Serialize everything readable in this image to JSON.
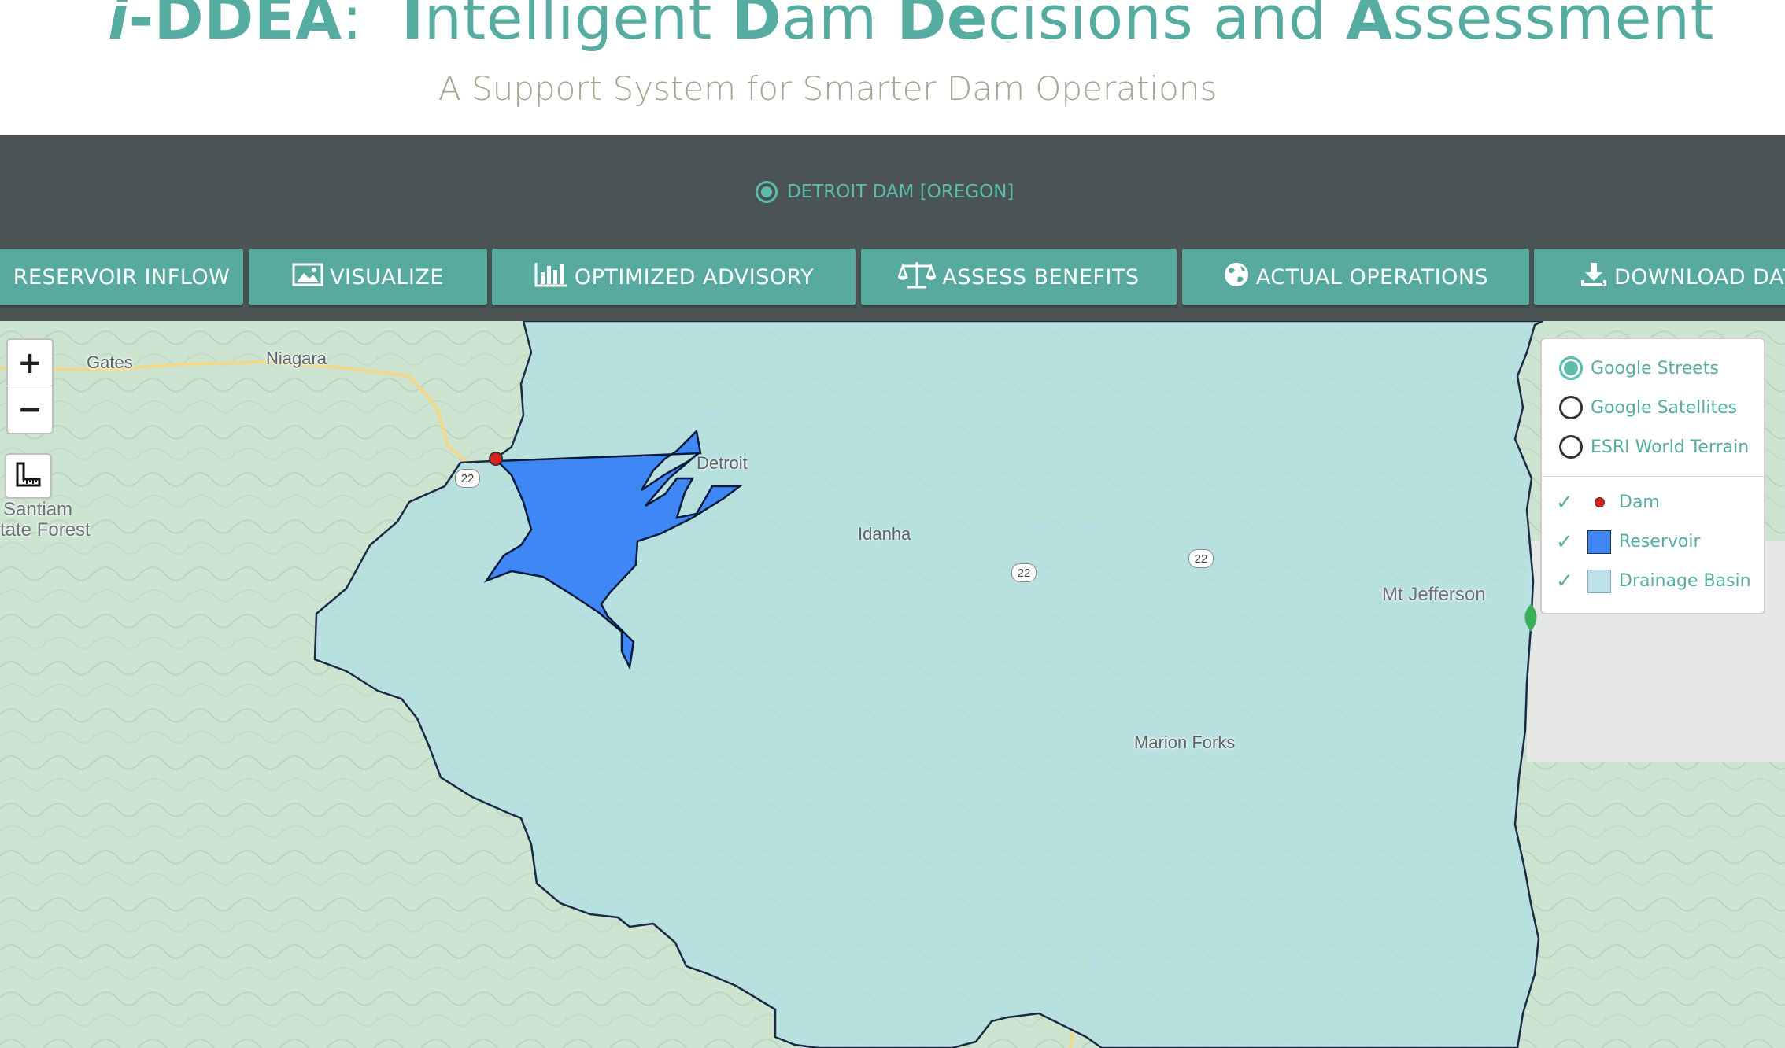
{
  "header": {
    "title": {
      "prefix_i": "i",
      "dash": "-",
      "acronym": "DDEA",
      "colon": ":",
      "w1_cap": "I",
      "w1_rest": "ntelligent",
      "w2_cap": "D",
      "w2_rest": "am",
      "w3_cap": "De",
      "w3_rest": "cisions and",
      "w4_cap": "A",
      "w4_rest": "ssessment"
    },
    "subtitle": "A Support System for Smarter Dam Operations"
  },
  "dam_selector": {
    "label": "DETROIT DAM [OREGON]"
  },
  "nav": {
    "reservoir_inflow": "RESERVOIR INFLOW",
    "visualize": "VISUALIZE",
    "optimized_advisory": "OPTIMIZED ADVISORY",
    "assess_benefits": "ASSESS BENEFITS",
    "actual_operations": "ACTUAL OPERATIONS",
    "download_data": "DOWNLOAD DATA"
  },
  "map": {
    "zoom_in": "+",
    "zoom_out": "−",
    "labels": {
      "gates": "Gates",
      "niagara": "Niagara",
      "detroit": "Detroit",
      "idanha": "Idanha",
      "santiam": "Santiam",
      "state_forest": "tate Forest",
      "mt_jefferson": "Mt Jefferson",
      "marion_forks": "Marion Forks"
    },
    "route_shield": "22"
  },
  "layers": {
    "base": [
      {
        "label": "Google Streets",
        "selected": true
      },
      {
        "label": "Google Satellites",
        "selected": false
      },
      {
        "label": "ESRI World Terrain",
        "selected": false
      }
    ],
    "overlays": [
      {
        "label": "Dam",
        "checked": true
      },
      {
        "label": "Reservoir",
        "checked": true
      },
      {
        "label": "Drainage Basin",
        "checked": true
      }
    ]
  },
  "colors": {
    "accent": "#56aca0",
    "band": "#4b5354",
    "reservoir": "#3f87f5",
    "basin": "#bfe1ea"
  }
}
